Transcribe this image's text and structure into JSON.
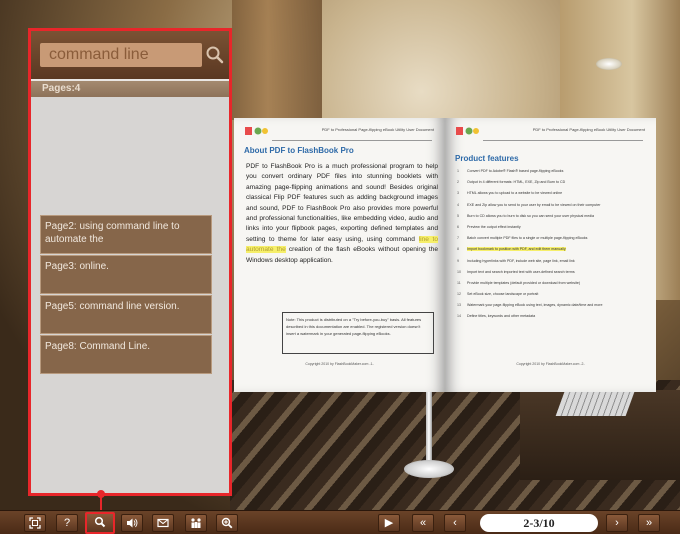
{
  "search": {
    "value": "command line"
  },
  "pages_label": "Pages:4",
  "results": [
    {
      "text": "Page2: using command line to automate the"
    },
    {
      "text": "Page3: online."
    },
    {
      "text": "Page5: command line version."
    },
    {
      "text": "Page8: Command Line."
    }
  ],
  "book": {
    "header": "PDF to Professional Page-flipping eBook Utility User Document",
    "left_page": {
      "title": "About PDF to FlashBook Pro",
      "body_before": "PDF to FlashBook Pro is a much professional program to help you convert ordinary PDF files into stunning booklets with amazing page-flipping animations and sound! Besides original classical Flip PDF features such as adding background images and sound, PDF to FlashBook Pro also provides more powerful and professional functionalities, like embedding video, audio and links into your flipbook pages, exporting defined templates and setting to theme for later easy using, using command ",
      "body_highlight": "line to automate the",
      "body_after": " creation of the flash eBooks without opening the Windows desktop application.",
      "note": "Note: This product is distributed on a \"Try before-you-buy\" basis. All features described in this documentation are enabled. The registered version doesn't insert a watermark in your generated page-flipping eBooks.",
      "footer": "Copyright 2010 by FlashBookMaker.com -1-"
    },
    "right_page": {
      "title": "Product features",
      "features": [
        {
          "num": "1",
          "text": "Convert PDF to Adobe® Flash® based page-flipping eBooks",
          "hl": false
        },
        {
          "num": "2",
          "text": "Output in 4 different formats: HTML, EXE, Zip and Burn to CD",
          "hl": false
        },
        {
          "num": "3",
          "text": "HTML allows you to upload to a website to be viewed online",
          "hl": false
        },
        {
          "num": "4",
          "text": "EXE and Zip allow you to send to your user by email to be viewed on their computer",
          "hl": false
        },
        {
          "num": "5",
          "text": "Burn to CD allows you to burn to disk so you can send your user physical media",
          "hl": false
        },
        {
          "num": "6",
          "text": "Preview the output effect instantly",
          "hl": false
        },
        {
          "num": "7",
          "text": "Batch convert multiple PDF files to a single or multiple page-flipping eBooks",
          "hl": false
        },
        {
          "num": "8",
          "text": "Import bookmark to position with PDF, and edit them manually",
          "hl": true
        },
        {
          "num": "9",
          "text": "Including hyperlinks with PDF, include web site, page link, email link",
          "hl": false
        },
        {
          "num": "10",
          "text": "Import text and search imported text with user-defined search terms",
          "hl": false
        },
        {
          "num": "11",
          "text": "Provide multiple templates (default provided or download from website)",
          "hl": false
        },
        {
          "num": "12",
          "text": "Set eBook size, choose landscape or portrait",
          "hl": false
        },
        {
          "num": "13",
          "text": "Watermark your page-flipping eBook using text, images, dynamic date/time and more",
          "hl": false
        },
        {
          "num": "14",
          "text": "Define titles, keywords and other metadata",
          "hl": false
        }
      ],
      "footer": "Copyright 2010 by FlashBookMaker.com -2-"
    }
  },
  "toolbar": {
    "page_indicator": "2-3/10"
  },
  "colors": {
    "accent_red": "#e8262a",
    "panel_bg": "#d7d5d3",
    "result_bg": "#86664a",
    "toolbar_bg": "#5a3620"
  }
}
